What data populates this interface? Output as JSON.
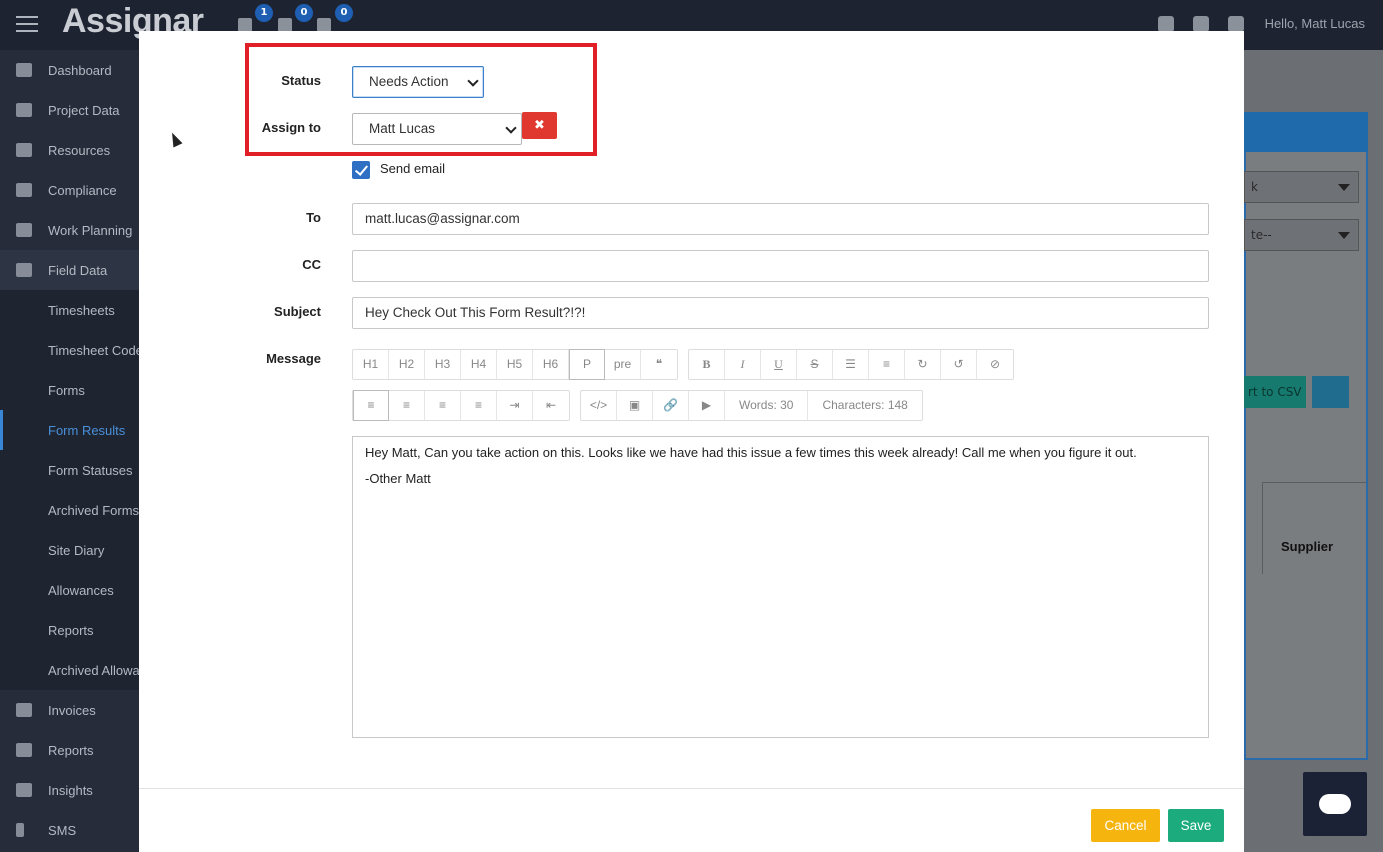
{
  "app": {
    "logo": "Assignar",
    "greeting": "Hello, Matt Lucas",
    "badges": [
      "1",
      "0",
      "0"
    ]
  },
  "sidebar": {
    "items": [
      {
        "label": "Dashboard",
        "icon": "gauge-icon"
      },
      {
        "label": "Project Data",
        "icon": "briefcase-icon"
      },
      {
        "label": "Resources",
        "icon": "bicycle-icon"
      },
      {
        "label": "Compliance",
        "icon": "graduation-cap-icon"
      },
      {
        "label": "Work Planning",
        "icon": "calendar-icon"
      },
      {
        "label": "Field Data",
        "icon": "file-icon"
      },
      {
        "label": "Timesheets"
      },
      {
        "label": "Timesheet Codes"
      },
      {
        "label": "Forms"
      },
      {
        "label": "Form Results"
      },
      {
        "label": "Form Statuses"
      },
      {
        "label": "Archived Forms"
      },
      {
        "label": "Site Diary"
      },
      {
        "label": "Allowances"
      },
      {
        "label": "Reports"
      },
      {
        "label": "Archived Allowances"
      },
      {
        "label": "Invoices",
        "icon": "list-icon"
      },
      {
        "label": "Reports",
        "icon": "bar-chart-icon"
      },
      {
        "label": "Insights",
        "icon": "line-chart-icon"
      },
      {
        "label": "SMS",
        "icon": "mobile-icon"
      }
    ]
  },
  "background": {
    "select1": "k",
    "select2": "te--",
    "csv_button": "rt to CSV",
    "column_header": "Supplier"
  },
  "form": {
    "status_label": "Status",
    "status_value": "Needs Action",
    "assign_label": "Assign to",
    "assign_value": "Matt Lucas",
    "remove_label": "✖",
    "send_email_label": "Send email",
    "to_label": "To",
    "to_value": "matt.lucas@assignar.com",
    "cc_label": "CC",
    "cc_value": "",
    "subject_label": "Subject",
    "subject_value": "Hey Check Out This Form Result?!?!",
    "message_label": "Message"
  },
  "toolbar": {
    "row1_group1": [
      "H1",
      "H2",
      "H3",
      "H4",
      "H5",
      "H6",
      "P",
      "pre",
      "❝"
    ],
    "row1_group2": [
      "B",
      "I",
      "U",
      "S",
      "☰",
      "≡",
      "↻",
      "↺",
      "⊘"
    ],
    "row2_group1": [
      "≡",
      "≡",
      "≡",
      "≡",
      "⇥",
      "⇤"
    ],
    "row2_group2": [
      "</>",
      "▣",
      "🔗",
      "▶"
    ],
    "words": "Words: 30",
    "characters": "Characters: 148"
  },
  "message": {
    "line1": "Hey Matt, Can you take action on this.  Looks like we have had this issue a few times this week already!  Call me when you figure it out.",
    "line2": "-Other Matt"
  },
  "buttons": {
    "cancel": "Cancel",
    "save": "Save"
  }
}
